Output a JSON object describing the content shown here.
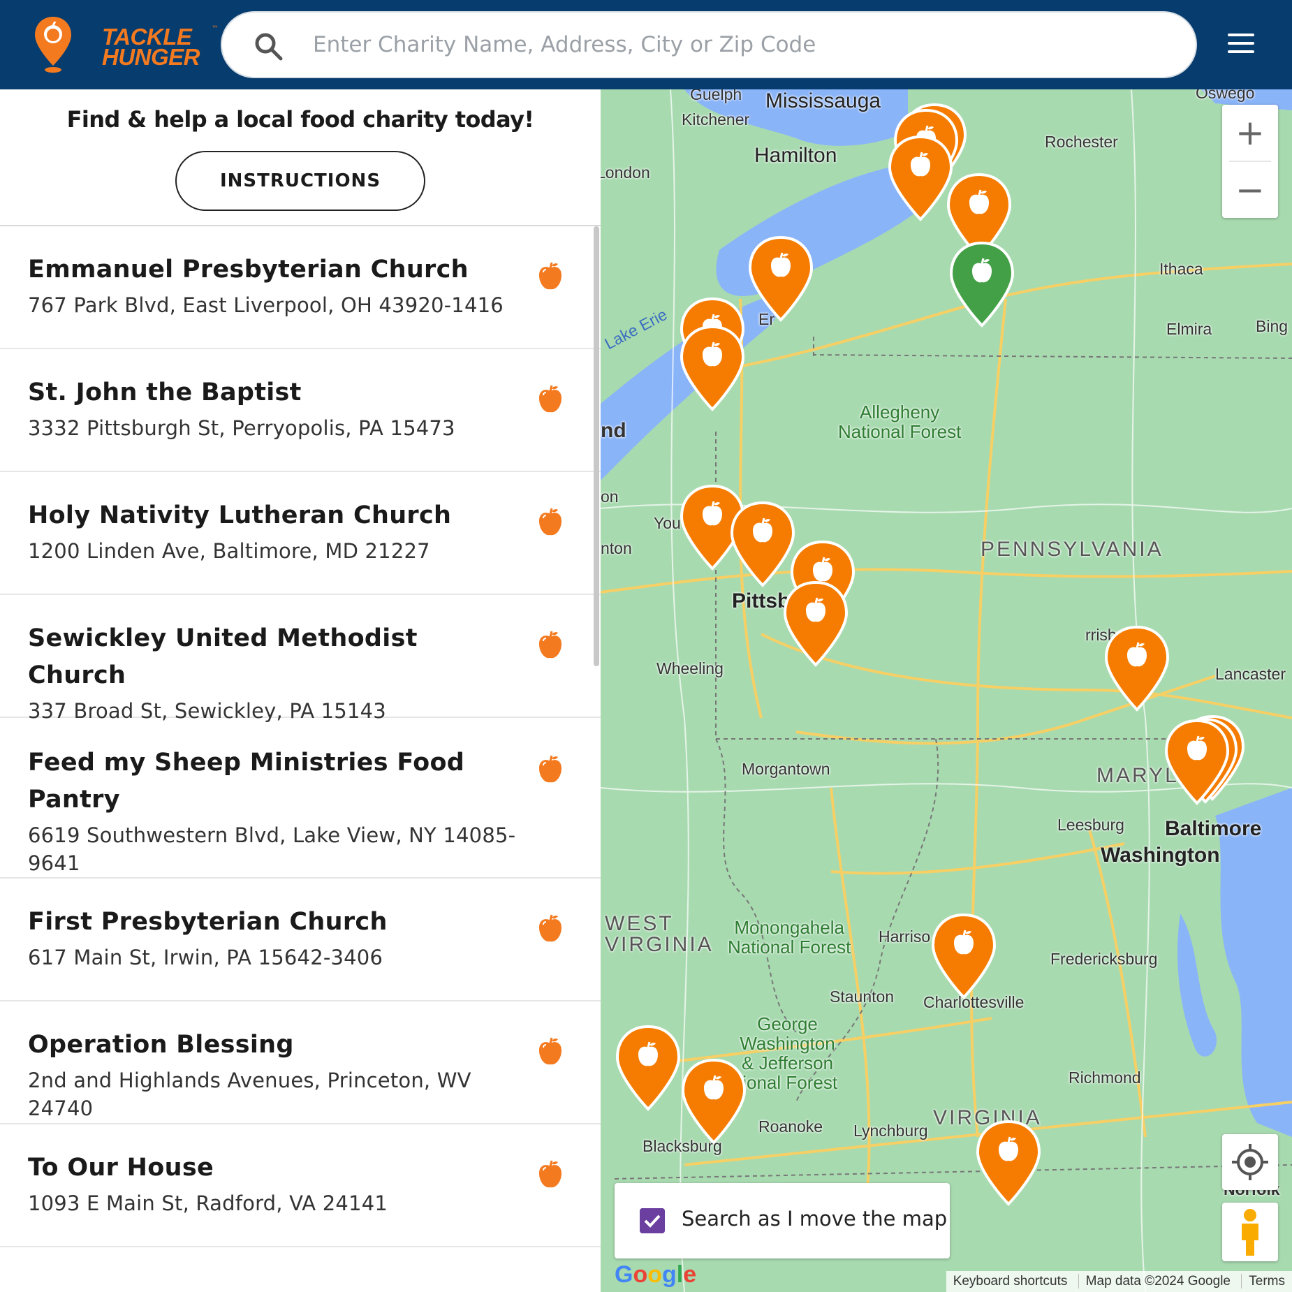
{
  "header": {
    "logo_line1": "TACKLE",
    "logo_line2": "HUNGER",
    "logo_tm": "™",
    "search_placeholder": "Enter Charity Name, Address, City or Zip Code"
  },
  "panel": {
    "tagline": "Find & help a local food charity today!",
    "instructions_label": "INSTRUCTIONS"
  },
  "charities": [
    {
      "name": "Emmanuel Presbyterian Church",
      "address": "767 Park Blvd, East Liverpool, OH 43920-1416"
    },
    {
      "name": "St. John the Baptist",
      "address": "3332 Pittsburgh St, Perryopolis, PA 15473"
    },
    {
      "name": "Holy Nativity Lutheran Church",
      "address": "1200 Linden Ave, Baltimore, MD 21227"
    },
    {
      "name": "Sewickley United Methodist Church",
      "address": "337 Broad St, Sewickley, PA 15143"
    },
    {
      "name": "Feed my Sheep Ministries Food Pantry",
      "address": "6619 Southwestern Blvd, Lake View, NY 14085-9641"
    },
    {
      "name": "First Presbyterian Church",
      "address": "617 Main St, Irwin, PA 15642-3406"
    },
    {
      "name": "Operation Blessing",
      "address": "2nd and Highlands Avenues, Princeton, WV 24740"
    },
    {
      "name": "To Our House",
      "address": "1093 E Main St, Radford, VA 24141"
    }
  ],
  "map": {
    "labels": {
      "guelph": "Guelph",
      "mississauga": "Mississauga",
      "kitchener": "Kitchener",
      "hamilton": "Hamilton",
      "london": "London",
      "rochester": "Rochester",
      "oswego": "Oswego",
      "ithaca": "Ithaca",
      "elmira": "Elmira",
      "binghamton": "Bing",
      "lake_erie": "Lake Erie",
      "erie": "Er",
      "allegheny": "Allegheny\nNational Forest",
      "pennsylvania": "PENNSYLVANIA",
      "youngstown": "You",
      "canton": "nton",
      "pittsburgh": "Pittsb",
      "wheeling": "Wheeling",
      "harrisburg": "rrisburg",
      "lancaster": "Lancaster",
      "morgantown": "Morgantown",
      "maryland": "MARYL",
      "baltimore": "Baltimore",
      "leesburg": "Leesburg",
      "washington": "Washington",
      "west_virginia": "WEST\nVIRGINIA",
      "monongahela": "Monongahela\nNational Forest",
      "harrisonburg": "Harriso",
      "fredericksburg": "Fredericksburg",
      "staunton": "Staunton",
      "charlottesville": "Charlottesville",
      "gw_forest": "George\nWashington\n& Jefferson\ntional Forest",
      "richmond": "Richmond",
      "roanoke": "Roanoke",
      "lynchburg": "Lynchburg",
      "virginia": "VIRGINIA",
      "blacksburg": "Blacksburg",
      "norfolk": "Norfolk",
      "cleveland": "nd",
      "columbus": "on"
    },
    "zoom_in": "+",
    "zoom_out": "−",
    "search_toggle_label": "Search as I move the map",
    "search_toggle_checked": true,
    "google": "Google",
    "attribution": [
      "Keyboard shortcuts",
      "Map data ©2024 Google",
      "Terms"
    ],
    "colors": {
      "pin_orange": "#f57c00",
      "pin_green": "#43a047",
      "header": "#073c6e",
      "accent": "#f47a20"
    }
  }
}
